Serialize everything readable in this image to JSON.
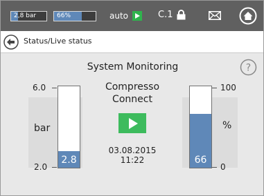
{
  "topbar": {
    "pressure_pill": "2,8 bar",
    "pressure_fraction": 0.2,
    "percent_pill": "66%",
    "percent_fraction": 0.66,
    "mode": "auto",
    "controller_id": "C.1"
  },
  "nav": {
    "breadcrumb": "Status/Live status"
  },
  "main": {
    "title": "System Monitoring",
    "help": "?",
    "brand_line1": "Compresso",
    "brand_line2": "Connect",
    "date": "03.08.2015",
    "time": "11:22"
  },
  "pressure_gauge": {
    "max_label": "6.0",
    "min_label": "2.0",
    "unit": "bar",
    "value_label": "2.8",
    "min": 2.0,
    "max": 6.0,
    "value": 2.8
  },
  "percent_gauge": {
    "max_label": "100",
    "min_label": "0",
    "unit": "%",
    "value_label": "66",
    "min": 0,
    "max": 100,
    "value": 66
  },
  "colors": {
    "gauge_fill": "#5f88b8",
    "play": "#3dbb5d",
    "topbar": "#606060"
  }
}
